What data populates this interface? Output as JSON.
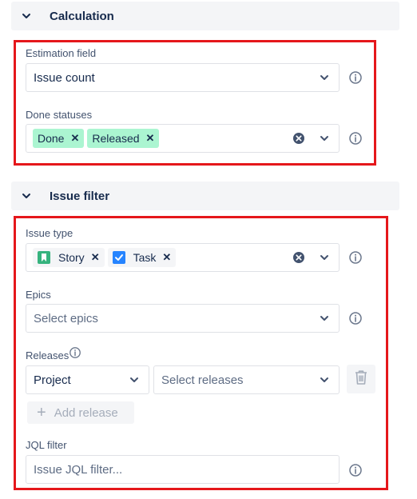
{
  "calculation": {
    "title": "Calculation",
    "estimation_label": "Estimation field",
    "estimation_value": "Issue count",
    "done_label": "Done statuses",
    "done_tags": [
      "Done",
      "Released"
    ]
  },
  "issue_filter": {
    "title": "Issue filter",
    "issue_type_label": "Issue type",
    "issue_types": [
      {
        "label": "Story",
        "icon": "story-icon",
        "color": "#36b37e"
      },
      {
        "label": "Task",
        "icon": "task-icon",
        "color": "#2684ff"
      }
    ],
    "epics_label": "Epics",
    "epics_placeholder": "Select epics",
    "releases_label": "Releases",
    "release_project_value": "Project",
    "release_placeholder": "Select releases",
    "add_release_label": "Add release",
    "jql_label": "JQL filter",
    "jql_placeholder": "Issue JQL filter..."
  },
  "colors": {
    "highlight": "#e5171b",
    "tag_green": "#abf5d1"
  }
}
